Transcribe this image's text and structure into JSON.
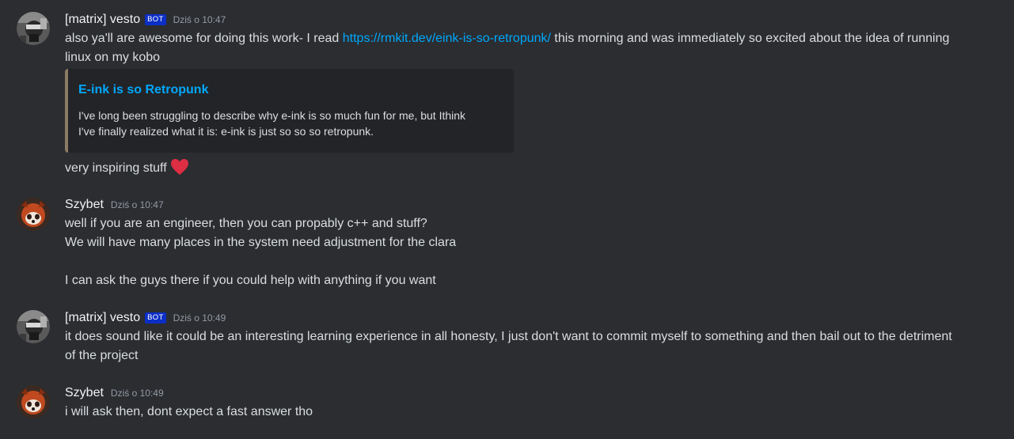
{
  "messages": [
    {
      "author": "[matrix] vesto",
      "bot_tag": "BOT",
      "timestamp": "Dziś o 10:47",
      "line1_pre": "also ya'll are awesome for doing this work- I read ",
      "link": "https://rmkit.dev/eink-is-so-retropunk/",
      "line1_post": " this morning and was immediately so excited about the idea of running",
      "line2": "linux on my kobo",
      "embed": {
        "title": "E-ink is so Retropunk",
        "desc_line1": "I've long been struggling to describe why e-ink is so much fun for me, but Ithink",
        "desc_line2": "I've finally realized what it is: e-ink is just so so so retropunk."
      },
      "line3": "very inspiring stuff",
      "emoji": "heart-icon"
    },
    {
      "author": "Szybet",
      "timestamp": "Dziś o 10:47",
      "lines": [
        "well if you are an engineer, then you can propably c++ and stuff?",
        "We will have many places in the system need adjustment for the clara",
        "I can ask the guys there if you could help with anything if you want"
      ]
    },
    {
      "author": "[matrix] vesto",
      "bot_tag": "BOT",
      "timestamp": "Dziś o 10:49",
      "lines": [
        "it does sound like it could be an interesting learning experience in all honesty, I just don't want to commit myself to something and then bail out to the detriment",
        "of the project"
      ]
    },
    {
      "author": "Szybet",
      "timestamp": "Dziś o 10:49",
      "lines": [
        "i will ask then, dont expect a fast answer tho"
      ]
    }
  ],
  "colors": {
    "background": "#2b2d31",
    "text": "#dbdee1",
    "username": "#f2f3f5",
    "timestamp": "#949ba4",
    "link": "#00a8fc",
    "bot_tag": "#0b2fc6",
    "embed_bg": "#232428",
    "embed_border": "#8c7b64",
    "heart": "#dd2e44"
  }
}
